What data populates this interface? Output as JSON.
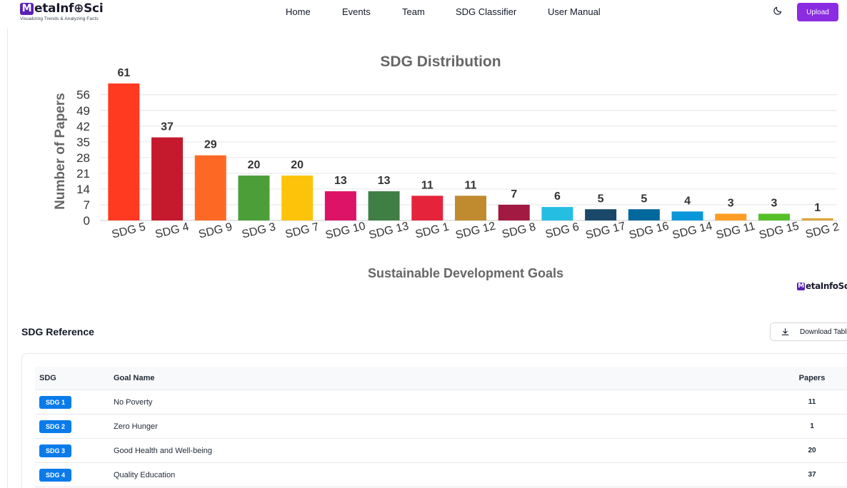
{
  "header": {
    "logo_text": "etaInf⊕Sci",
    "logo_letter": "M",
    "logo_tagline": "Visualizing Trends & Analyzing Facts",
    "nav": [
      "Home",
      "Events",
      "Team",
      "SDG Classifier",
      "User Manual"
    ],
    "upload_label": "Upload",
    "theme_icon": "moon-icon"
  },
  "chart_data": {
    "type": "bar",
    "title": "SDG Distribution",
    "xlabel": "Sustainable Development Goals",
    "ylabel": "Number of Papers",
    "categories": [
      "SDG 5",
      "SDG 4",
      "SDG 9",
      "SDG 3",
      "SDG 7",
      "SDG 10",
      "SDG 13",
      "SDG 1",
      "SDG 12",
      "SDG 8",
      "SDG 6",
      "SDG 17",
      "SDG 16",
      "SDG 14",
      "SDG 11",
      "SDG 15",
      "SDG 2"
    ],
    "values": [
      61,
      37,
      29,
      20,
      20,
      13,
      13,
      11,
      11,
      7,
      6,
      5,
      5,
      4,
      3,
      3,
      1
    ],
    "colors": [
      "#ff3a21",
      "#c5192d",
      "#fd6925",
      "#4c9f38",
      "#fcc30b",
      "#dd1367",
      "#3f7e44",
      "#e5243b",
      "#bf8b2e",
      "#a21942",
      "#26bde2",
      "#19486a",
      "#00689d",
      "#0a97d9",
      "#fd9d24",
      "#56c02b",
      "#dda63a"
    ],
    "yticks": [
      0,
      7,
      14,
      21,
      28,
      35,
      42,
      49,
      56
    ],
    "ylim": [
      0,
      61
    ],
    "grid": true,
    "data_labels": true
  },
  "watermark": {
    "letter": "M",
    "text": "etaInfoSci"
  },
  "reference": {
    "title": "SDG Reference",
    "download_label": "Download Table",
    "columns": [
      "SDG",
      "Goal Name",
      "Papers"
    ],
    "rows": [
      {
        "sdg": "SDG 1",
        "goal": "No Poverty",
        "papers": "11"
      },
      {
        "sdg": "SDG 2",
        "goal": "Zero Hunger",
        "papers": "1"
      },
      {
        "sdg": "SDG 3",
        "goal": "Good Health and Well-being",
        "papers": "20"
      },
      {
        "sdg": "SDG 4",
        "goal": "Quality Education",
        "papers": "37"
      }
    ]
  }
}
